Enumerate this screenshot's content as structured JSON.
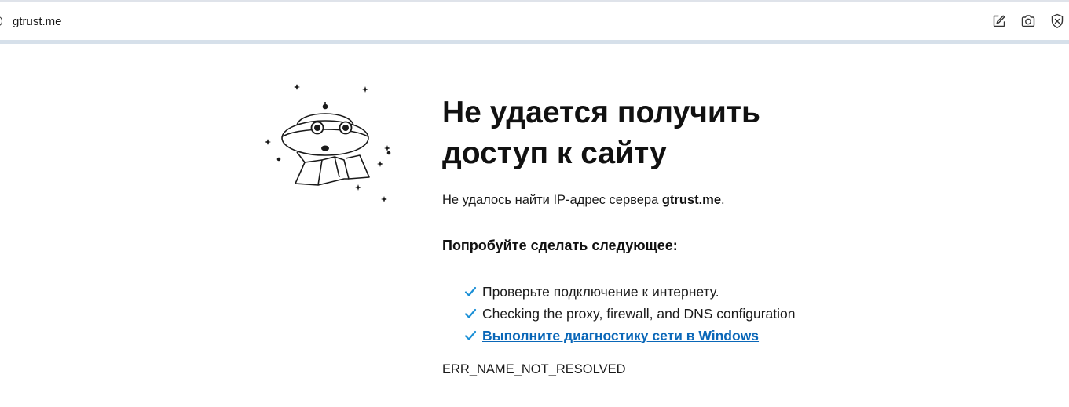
{
  "address_bar": {
    "url": "gtrust.me",
    "icons": [
      "edit-icon",
      "camera-icon",
      "shield-icon"
    ]
  },
  "error": {
    "title": "Не удается получить доступ к сайту",
    "subtitle_prefix": "Не удалось найти IP-адрес сервера ",
    "subtitle_host": "gtrust.me",
    "subtitle_suffix": ".",
    "try_heading": "Попробуйте сделать следующее:",
    "suggestions": [
      {
        "text": "Проверьте подключение к интернету.",
        "link": false
      },
      {
        "text": "Checking the proxy, firewall, and DNS configuration",
        "link": false
      },
      {
        "text": "Выполните диагностику сети в Windows",
        "link": true
      }
    ],
    "code": "ERR_NAME_NOT_RESOLVED"
  },
  "colors": {
    "link": "#0a67b8",
    "check": "#1a8fd6"
  }
}
